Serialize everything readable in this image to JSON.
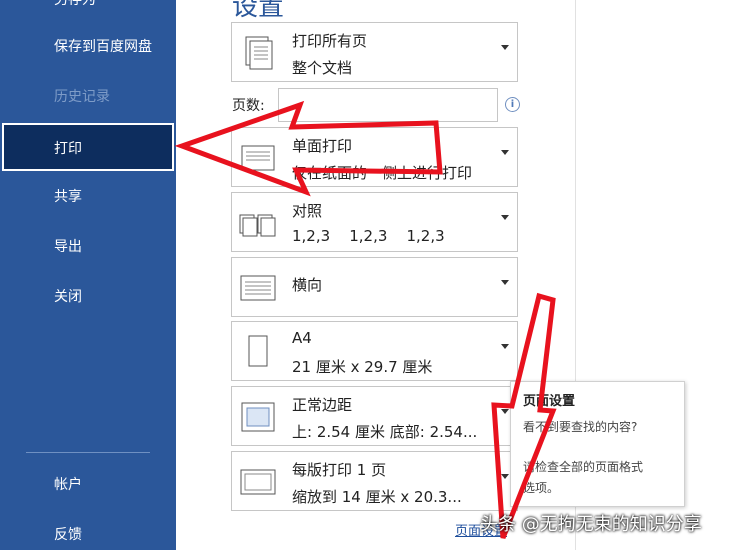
{
  "sidebar": {
    "top_partial": "另存为",
    "items": [
      {
        "label": "保存到百度网盘",
        "state": "normal"
      },
      {
        "label": "历史记录",
        "state": "disabled"
      },
      {
        "label": "打印",
        "state": "selected"
      },
      {
        "label": "共享",
        "state": "normal"
      },
      {
        "label": "导出",
        "state": "normal"
      },
      {
        "label": "关闭",
        "state": "normal"
      }
    ],
    "bottom_items": [
      {
        "label": "帐户"
      },
      {
        "label": "反馈"
      }
    ]
  },
  "main": {
    "title": "设置",
    "print_range": {
      "line1": "打印所有页",
      "line2": "整个文档"
    },
    "pages": {
      "label": "页数:",
      "value": "",
      "info_icon": "info-icon"
    },
    "sides": {
      "line1": "单面打印",
      "line2": "仅在纸面的一侧上进行打印"
    },
    "collate": {
      "line1": "对照",
      "line2": "1,2,3    1,2,3    1,2,3"
    },
    "orientation": {
      "line1": "横向"
    },
    "paper": {
      "line1": "A4",
      "line2": "21 厘米 x 29.7 厘米"
    },
    "margins": {
      "line1": "正常边距",
      "line2": "上: 2.54 厘米 底部: 2.54..."
    },
    "per_sheet": {
      "line1": "每版打印 1 页",
      "line2": "缩放到 14 厘米 x 20.3..."
    },
    "page_setup_link": "页面设置"
  },
  "tooltip": {
    "title": "页面设置",
    "line1": "看不到要查找的内容?",
    "line2": "请检查全部的页面格式",
    "line3": "选项。"
  },
  "watermark": "头条 @无拘无束的知识分享",
  "colors": {
    "sidebar": "#2b579a",
    "sidebar_selected": "#0d2d5e",
    "arrow": "#e8121e",
    "accent_text": "#2b579a"
  }
}
